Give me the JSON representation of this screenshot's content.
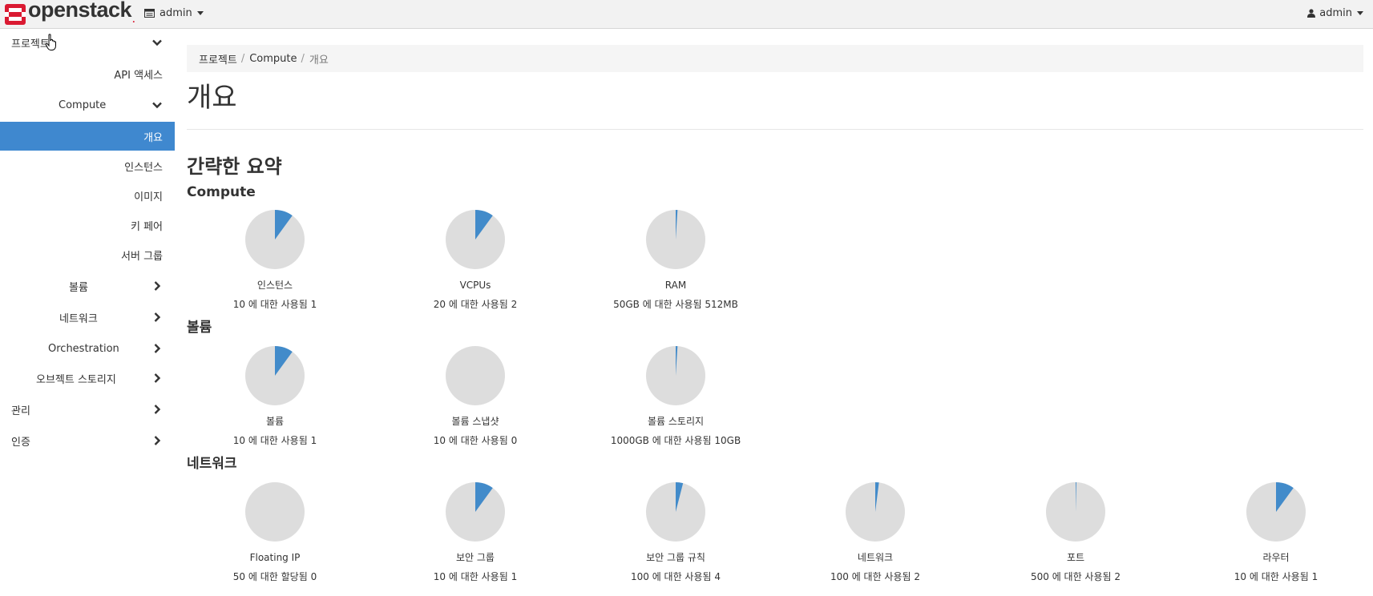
{
  "navbar": {
    "brand": "openstack",
    "brand_dot": ".",
    "project_switcher": "admin",
    "user_menu": "admin",
    "brand_color": "#da1a32"
  },
  "sidebar": {
    "project": "프로젝트",
    "api_access": "API 액세스",
    "compute": "Compute",
    "overview": "개요",
    "instances": "인스턴스",
    "images": "이미지",
    "key_pairs": "키 페어",
    "server_groups": "서버 그룹",
    "volumes": "볼륨",
    "network": "네트워크",
    "orchestration": "Orchestration",
    "object_storage": "오브젝트 스토리지",
    "admin": "관리",
    "identity": "인증",
    "active_color": "#3f88cf"
  },
  "breadcrumb": {
    "project": "프로젝트",
    "compute": "Compute",
    "current": "개요",
    "separator": "/"
  },
  "page": {
    "title": "개요",
    "summary_title": "간략한 요약"
  },
  "chart_data": {
    "type": "pie",
    "used_color": "#428bca",
    "free_color": "#dddddd",
    "groups": [
      {
        "title": "Compute",
        "charts": [
          {
            "name": "인스턴스",
            "usage": "10 에 대한 사용됨 1",
            "used": 1,
            "total": 10
          },
          {
            "name": "VCPUs",
            "usage": "20 에 대한 사용됨 2",
            "used": 2,
            "total": 20
          },
          {
            "name": "RAM",
            "usage": "50GB 에 대한 사용됨 512MB",
            "used": 0.5,
            "total": 50
          }
        ]
      },
      {
        "title": "볼륨",
        "charts": [
          {
            "name": "볼륨",
            "usage": "10 에 대한 사용됨 1",
            "used": 1,
            "total": 10
          },
          {
            "name": "볼륨 스냅샷",
            "usage": "10 에 대한 사용됨 0",
            "used": 0,
            "total": 10
          },
          {
            "name": "볼륨 스토리지",
            "usage": "1000GB 에 대한 사용됨 10GB",
            "used": 10,
            "total": 1000
          }
        ]
      },
      {
        "title": "네트워크",
        "charts": [
          {
            "name": "Floating IP",
            "usage": "50 에 대한 할당됨 0",
            "used": 0,
            "total": 50
          },
          {
            "name": "보안 그룹",
            "usage": "10 에 대한 사용됨 1",
            "used": 1,
            "total": 10
          },
          {
            "name": "보안 그룹 규칙",
            "usage": "100 에 대한 사용됨 4",
            "used": 4,
            "total": 100
          },
          {
            "name": "네트워크",
            "usage": "100 에 대한 사용됨 2",
            "used": 2,
            "total": 100
          },
          {
            "name": "포트",
            "usage": "500 에 대한 사용됨 2",
            "used": 2,
            "total": 500
          },
          {
            "name": "라우터",
            "usage": "10 에 대한 사용됨 1",
            "used": 1,
            "total": 10
          }
        ]
      }
    ]
  }
}
